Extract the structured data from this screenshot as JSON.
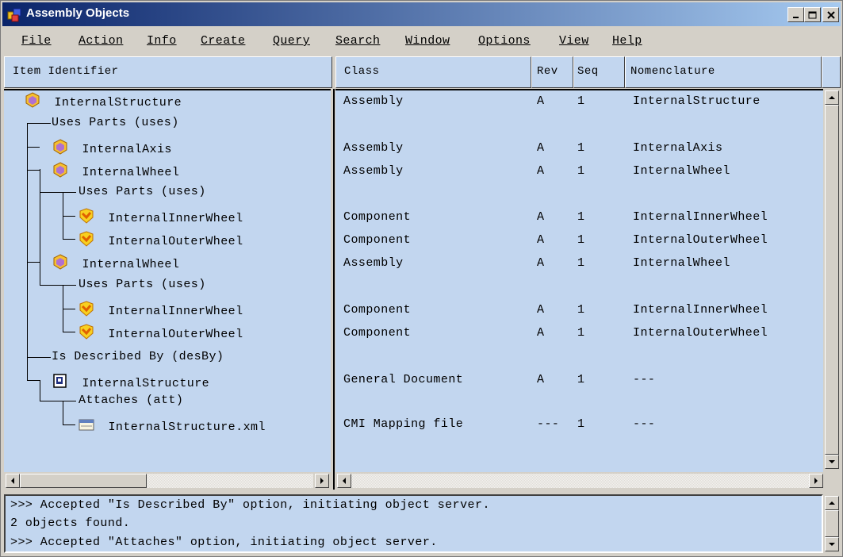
{
  "window": {
    "title": "Assembly Objects"
  },
  "menu": [
    "File",
    "Action",
    "Info",
    "Create",
    "Query",
    "Search",
    "Window",
    "Options",
    "View",
    "Help"
  ],
  "columns": {
    "item": "Item Identifier",
    "class": "Class",
    "rev": "Rev",
    "seq": "Seq",
    "nomenclature": "Nomenclature"
  },
  "rows": [
    {
      "label": "InternalStructure",
      "icon": "assembly-icon",
      "class": "Assembly",
      "rev": "A",
      "seq": "1",
      "nom": "InternalStructure"
    },
    {
      "label": "Uses Parts (uses)",
      "icon": "",
      "class": "",
      "rev": "",
      "seq": "",
      "nom": ""
    },
    {
      "label": "InternalAxis",
      "icon": "assembly-icon",
      "class": "Assembly",
      "rev": "A",
      "seq": "1",
      "nom": "InternalAxis"
    },
    {
      "label": "InternalWheel",
      "icon": "assembly-icon",
      "class": "Assembly",
      "rev": "A",
      "seq": "1",
      "nom": "InternalWheel"
    },
    {
      "label": "Uses Parts (uses)",
      "icon": "",
      "class": "",
      "rev": "",
      "seq": "",
      "nom": ""
    },
    {
      "label": "InternalInnerWheel",
      "icon": "component-icon",
      "class": "Component",
      "rev": "A",
      "seq": "1",
      "nom": "InternalInnerWheel"
    },
    {
      "label": "InternalOuterWheel",
      "icon": "component-icon",
      "class": "Component",
      "rev": "A",
      "seq": "1",
      "nom": "InternalOuterWheel"
    },
    {
      "label": "InternalWheel",
      "icon": "assembly-icon",
      "class": "Assembly",
      "rev": "A",
      "seq": "1",
      "nom": "InternalWheel"
    },
    {
      "label": "Uses Parts (uses)",
      "icon": "",
      "class": "",
      "rev": "",
      "seq": "",
      "nom": ""
    },
    {
      "label": "InternalInnerWheel",
      "icon": "component-icon",
      "class": "Component",
      "rev": "A",
      "seq": "1",
      "nom": "InternalInnerWheel"
    },
    {
      "label": "InternalOuterWheel",
      "icon": "component-icon",
      "class": "Component",
      "rev": "A",
      "seq": "1",
      "nom": "InternalOuterWheel"
    },
    {
      "label": "Is Described By (desBy)",
      "icon": "",
      "class": "",
      "rev": "",
      "seq": "",
      "nom": ""
    },
    {
      "label": "InternalStructure",
      "icon": "document-icon",
      "class": "General Document",
      "rev": "A",
      "seq": "1",
      "nom": "---"
    },
    {
      "label": "Attaches (att)",
      "icon": "",
      "class": "",
      "rev": "",
      "seq": "",
      "nom": ""
    },
    {
      "label": "InternalStructure.xml",
      "icon": "file-icon",
      "class": "CMI Mapping file",
      "rev": "---",
      "seq": "1",
      "nom": "---"
    }
  ],
  "log": [
    ">>> Accepted \"Is Described By\" option, initiating object server.",
    "2 objects found.",
    ">>> Accepted \"Attaches\" option, initiating object server."
  ],
  "colors": {
    "title_start": "#0a246a",
    "title_end": "#a6caf0",
    "pane_bg": "#c2d6ef",
    "chrome": "#d4d0c8"
  }
}
